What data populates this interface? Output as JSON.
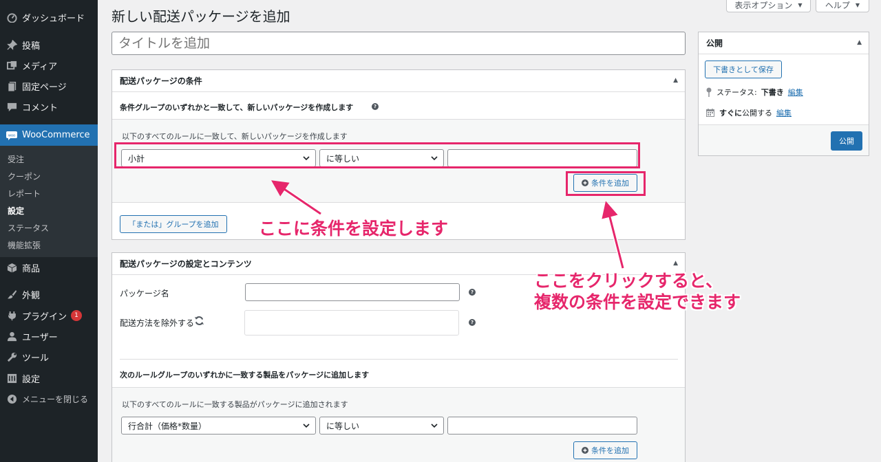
{
  "sidebar": {
    "items": [
      {
        "label": "ダッシュボード",
        "icon": "dashboard-icon"
      },
      {
        "label": "投稿",
        "icon": "pin-icon"
      },
      {
        "label": "メディア",
        "icon": "media-icon"
      },
      {
        "label": "固定ページ",
        "icon": "page-icon"
      },
      {
        "label": "コメント",
        "icon": "comment-icon"
      },
      {
        "label": "WooCommerce",
        "icon": "woo-icon"
      },
      {
        "label": "商品",
        "icon": "box-icon"
      },
      {
        "label": "外観",
        "icon": "brush-icon"
      },
      {
        "label": "プラグイン",
        "icon": "plugin-icon",
        "badge": "1"
      },
      {
        "label": "ユーザー",
        "icon": "user-icon"
      },
      {
        "label": "ツール",
        "icon": "wrench-icon"
      },
      {
        "label": "設定",
        "icon": "settings-icon"
      },
      {
        "label": "メニューを閉じる",
        "icon": "collapse-icon"
      }
    ],
    "submenu": [
      "受注",
      "クーポン",
      "レポート",
      "設定",
      "ステータス",
      "機能拡張"
    ]
  },
  "top": {
    "screen_options": "表示オプション",
    "help": "ヘルプ"
  },
  "page_title": "新しい配送パッケージを追加",
  "title_placeholder": "タイトルを追加",
  "conditions": {
    "title": "配送パッケージの条件",
    "group_desc": "条件グループのいずれかと一致して、新しいパッケージを作成します",
    "rule_desc": "以下のすべてのルールに一致して、新しいパッケージを作成します",
    "field": "小計",
    "operator": "に等しい",
    "add_condition": "条件を追加",
    "add_or_group": "「または」グループを追加"
  },
  "settings": {
    "title": "配送パッケージの設定とコンテンツ",
    "package_name_label": "パッケージ名",
    "exclude_label": "配送方法を除外する",
    "product_group_desc": "次のルールグループのいずれかに一致する製品をパッケージに追加します",
    "product_rule_desc": "以下のすべてのルールに一致する製品がパッケージに追加されます",
    "field": "行合計（価格*数量）",
    "operator": "に等しい",
    "add_condition": "条件を追加"
  },
  "publish": {
    "title": "公開",
    "save_draft": "下書きとして保存",
    "status_label": "ステータス:",
    "status_value": "下書き",
    "edit": "編集",
    "publish_label_bold": "すぐに",
    "publish_label": "公開する",
    "edit2": "編集",
    "publish_button": "公開"
  },
  "annotations": {
    "a1": "ここに条件を設定します",
    "a2_line1": "ここをクリックすると、",
    "a2_line2": "複数の条件を設定できます"
  },
  "colors": {
    "sidebar": "#1d2327",
    "accent": "#2271b1",
    "annotation": "#e6266b"
  }
}
